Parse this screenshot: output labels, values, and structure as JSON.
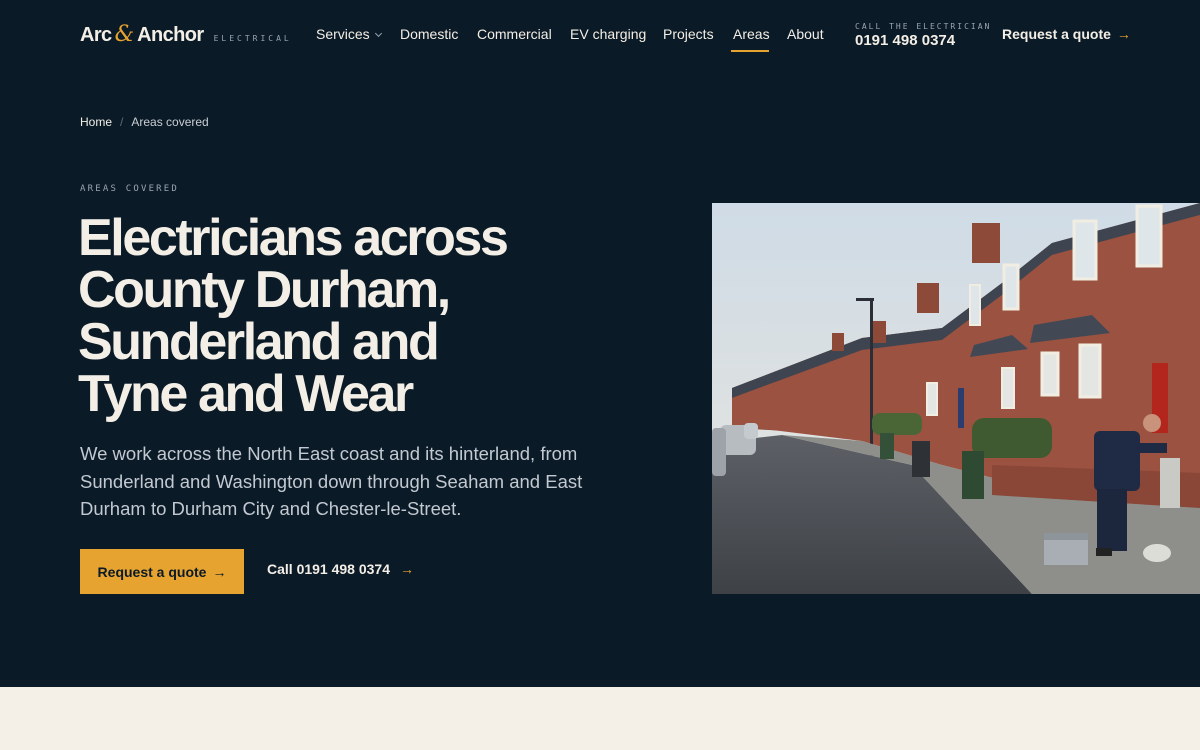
{
  "brand": {
    "name_part1": "Arc",
    "ampersand": "&",
    "name_part2": "Anchor",
    "tagline": "ELECTRICAL"
  },
  "nav": {
    "items": [
      {
        "label": "Services",
        "has_dropdown": true
      },
      {
        "label": "Domestic"
      },
      {
        "label": "Commercial"
      },
      {
        "label": "EV charging"
      },
      {
        "label": "Projects"
      },
      {
        "label": "Areas",
        "active": true
      },
      {
        "label": "About"
      }
    ],
    "phone_label": "CALL THE ELECTRICIAN",
    "phone_number": "0191 498 0374",
    "cta_label": "Request a quote",
    "cta_arrow": "→"
  },
  "breadcrumb": {
    "home": "Home",
    "separator": "/",
    "current": "Areas covered"
  },
  "hero": {
    "eyebrow": "AREAS COVERED",
    "title_lines": [
      "Electricians across",
      "County Durham,",
      "Sunderland and",
      "Tyne and Wear"
    ],
    "description": "We work across the North East coast and its hinterland, from Sunderland and Washington down through Seaham and East Durham to Durham City and Chester-le-Street.",
    "primary_cta": "Request a quote",
    "primary_cta_arrow": "→",
    "secondary_cta": "Call 0191 498 0374",
    "secondary_cta_arrow": "→",
    "image_icon": "terraced-street-photo"
  },
  "colors": {
    "background": "#0b1a27",
    "accent": "#e6a330",
    "text": "#f3efe6",
    "muted": "#9aa5b1",
    "light_band": "#f4f0e8"
  }
}
